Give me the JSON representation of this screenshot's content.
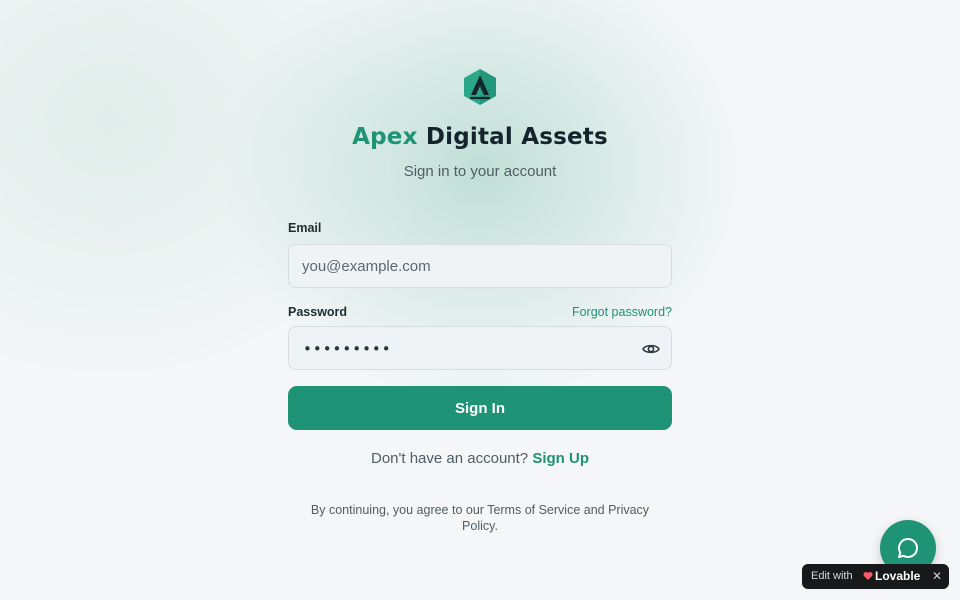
{
  "brand": {
    "name_accent": "Apex",
    "name_rest": "Digital Assets",
    "subtitle": "Sign in to your account",
    "logo_icon": "hexagon-logo-icon",
    "accent_color": "#1f9375"
  },
  "form": {
    "email_label": "Email",
    "email_placeholder": "you@example.com",
    "password_label": "Password",
    "password_masked": "•••••••••",
    "forgot_label": "Forgot password?",
    "eye_icon": "eye-icon",
    "submit_label": "Sign In"
  },
  "signup": {
    "prompt": "Don't have an account?",
    "link_label": "Sign Up"
  },
  "legal": {
    "text": "By continuing, you agree to our Terms of Service and Privacy Policy."
  },
  "widgets": {
    "chat_icon": "chat-bubble-icon",
    "badge_prefix": "Edit with",
    "badge_name": "Lovable",
    "badge_close": "✕"
  }
}
